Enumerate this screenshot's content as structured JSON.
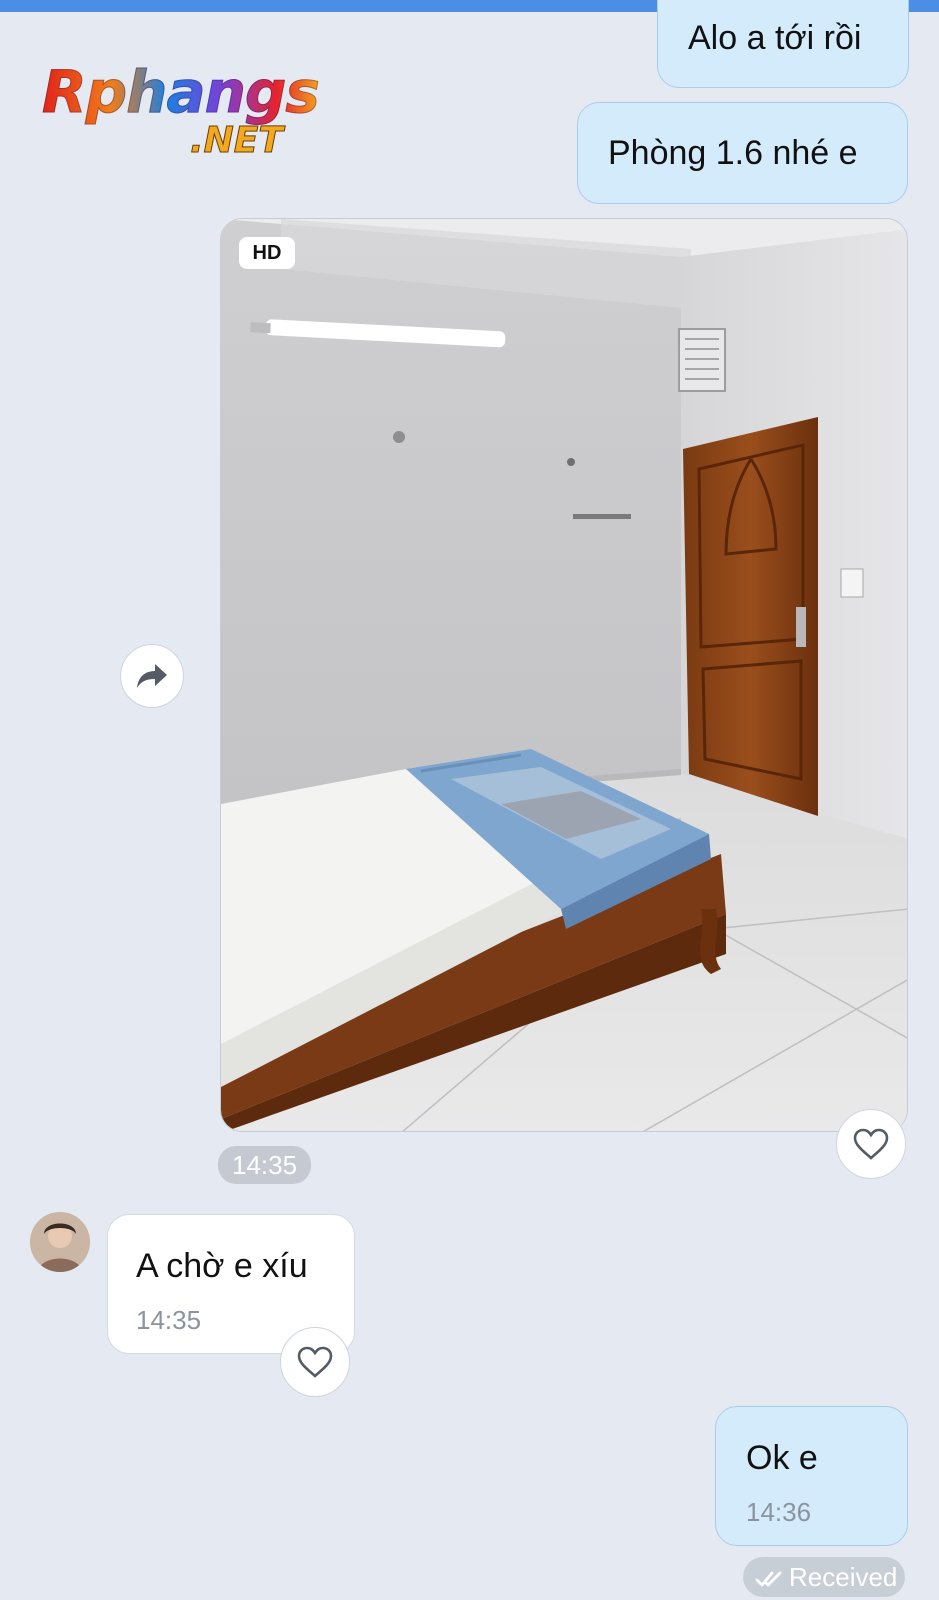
{
  "logo": {
    "main": "Rphangs",
    "suffix": ".NET"
  },
  "messages": {
    "out1": {
      "text": "Alo a tới rồi"
    },
    "out2": {
      "text": "Phòng 1.6 nhé e"
    },
    "photo": {
      "badge": "HD",
      "time": "14:35"
    },
    "in1": {
      "text": "A chờ e xíu",
      "time": "14:35"
    },
    "out3": {
      "text": "Ok e",
      "time": "14:36"
    }
  },
  "status": {
    "label": "Received"
  },
  "icons": {
    "forward": "forward-arrow-icon",
    "like": "heart-icon",
    "status": "double-check-icon"
  }
}
